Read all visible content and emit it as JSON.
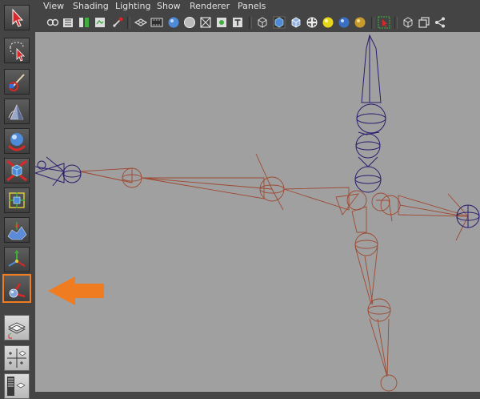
{
  "menu": {
    "items": [
      {
        "key": "view",
        "label": "View"
      },
      {
        "key": "shading",
        "label": "Shading"
      },
      {
        "key": "lighting",
        "label": "Lighting"
      },
      {
        "key": "show",
        "label": "Show"
      },
      {
        "key": "renderer",
        "label": "Renderer"
      },
      {
        "key": "panels",
        "label": "Panels"
      }
    ]
  },
  "toolbox": {
    "tools": [
      {
        "name": "select-tool-icon"
      },
      {
        "name": "lasso-tool-icon"
      },
      {
        "name": "paint-select-tool-icon"
      },
      {
        "name": "universal-manipulator-icon"
      },
      {
        "name": "move-tool-icon"
      },
      {
        "name": "rotate-tool-icon"
      },
      {
        "name": "scale-tool-icon"
      },
      {
        "name": "soft-modification-icon"
      },
      {
        "name": "show-manipulator-icon"
      },
      {
        "name": "joint-tool-icon",
        "active": true
      }
    ],
    "layouts": [
      {
        "name": "single-perspective-layout-icon"
      },
      {
        "name": "four-view-layout-icon"
      },
      {
        "name": "outliner-layout-icon"
      }
    ]
  },
  "colors": {
    "accent": "#f07c22",
    "joint_bone": "#9e4a32",
    "joint_selected": "#2a1c6e",
    "viewport_bg": "#a0a0a0",
    "ui_bg": "#444444"
  },
  "annotation": {
    "arrow_target": "joint-tool-icon"
  }
}
